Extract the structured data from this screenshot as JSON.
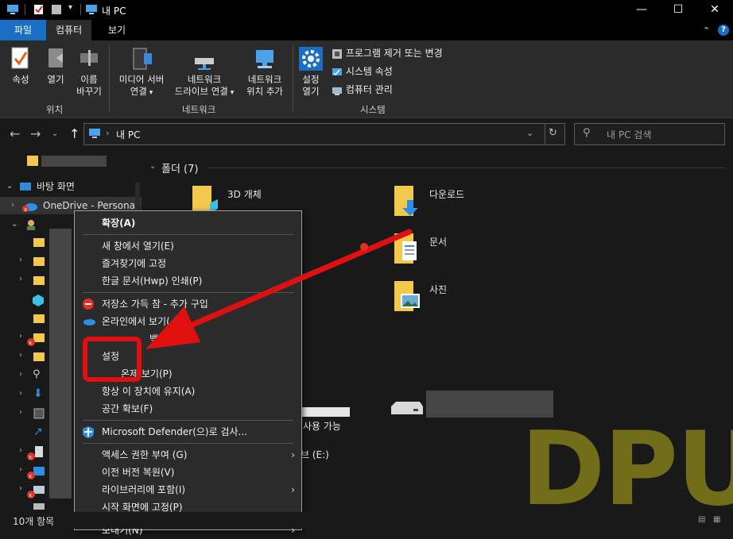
{
  "window": {
    "title": "내 PC"
  },
  "tabs": [
    {
      "label": "파일"
    },
    {
      "label": "컴퓨터"
    },
    {
      "label": "보기"
    }
  ],
  "ribbon": {
    "location": {
      "props": "속성",
      "open": "열기",
      "rename_1": "이름",
      "rename_2": "바꾸기",
      "group": "위치"
    },
    "network": {
      "media_1": "미디어 서버",
      "media_2": "연결",
      "drive_1": "네트워크",
      "drive_2": "드라이브 연결",
      "add_1": "네트워크",
      "add_2": "위치 추가",
      "group": "네트워크"
    },
    "system": {
      "settings_1": "설정",
      "settings_2": "열기",
      "uninstall": "프로그램 제거 또는 변경",
      "sysprops": "시스템 속성",
      "manage": "컴퓨터 관리",
      "group": "시스템"
    }
  },
  "address": {
    "path": "내 PC",
    "search_placeholder": "내 PC 검색"
  },
  "navpane": {
    "desktop": "바탕 화면",
    "onedrive": "OneDrive - Persona"
  },
  "content": {
    "folders_header": "폴더 (7)",
    "folders": {
      "f3d": "3D 개체",
      "downloads": "다운로드",
      "documents": "문서",
      "pictures": "사진"
    },
    "drive_free": "사용 가능",
    "drive_e": "브 (E:)"
  },
  "context_menu": {
    "items": [
      "확장(A)",
      "새 창에서 열기(E)",
      "즐겨찾기에 고정",
      "한글 문서(Hwp) 인쇄(P)",
      "저장소 가득 참 - 추가 구입",
      "온라인에서 보기(",
      "백업",
      "설정",
      "온제 보기(P)",
      "항상 이 장치에 유지(A)",
      "공간 확보(F)",
      "Microsoft Defender(으)로 검사...",
      "액세스 권한 부여 (G)",
      "이전 버전 복원(V)",
      "라이브러리에 포함(I)",
      "시작 화면에 고정(P)",
      "보내기(N)"
    ]
  },
  "status": {
    "count": "10개 항목"
  },
  "watermark": "DPU",
  "colors": {
    "accent": "#1a6fc4",
    "arrow": "#e01010",
    "highlight_box": "#e01010",
    "watermark": "#8f8a1a"
  }
}
